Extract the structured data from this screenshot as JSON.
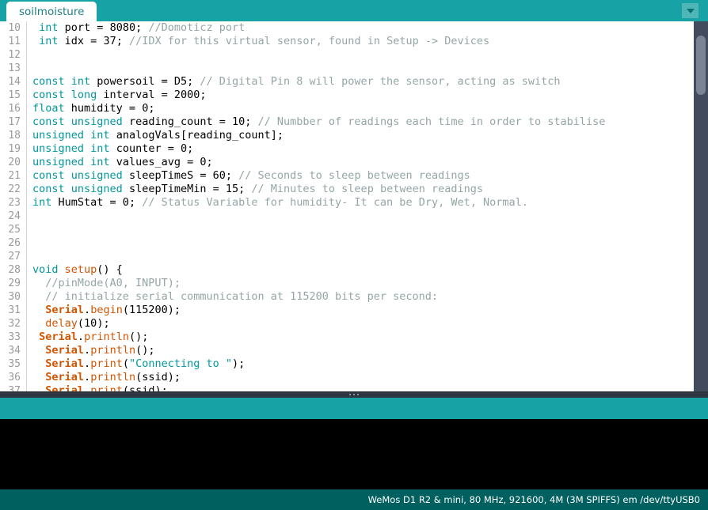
{
  "window": {
    "title": "soilmoisture",
    "theme_accent": "#17a2a5",
    "status_bar_color": "#00605f",
    "console_bg": "#000000",
    "splitter_color": "#2e3440"
  },
  "tabbar": {
    "tabs": [
      {
        "label": "soilmoisture",
        "active": true
      }
    ],
    "menu_button_icon": "chevron-down-icon"
  },
  "editor": {
    "first_visible_line": 10,
    "last_visible_line": 37,
    "lines": [
      {
        "n": "10",
        "tokens": [
          {
            "t": " ",
            "c": "op"
          },
          {
            "t": "int",
            "c": "kw"
          },
          {
            "t": " port = ",
            "c": "op"
          },
          {
            "t": "8080",
            "c": "num"
          },
          {
            "t": "; ",
            "c": "op"
          },
          {
            "t": "//Domoticz port",
            "c": "cmt"
          }
        ]
      },
      {
        "n": "11",
        "tokens": [
          {
            "t": " ",
            "c": "op"
          },
          {
            "t": "int",
            "c": "kw"
          },
          {
            "t": " idx = ",
            "c": "op"
          },
          {
            "t": "37",
            "c": "num"
          },
          {
            "t": "; ",
            "c": "op"
          },
          {
            "t": "//IDX for this virtual sensor, found in Setup -> Devices",
            "c": "cmt"
          }
        ]
      },
      {
        "n": "12",
        "tokens": []
      },
      {
        "n": "13",
        "tokens": []
      },
      {
        "n": "14",
        "tokens": [
          {
            "t": "const",
            "c": "kw"
          },
          {
            "t": " ",
            "c": "op"
          },
          {
            "t": "int",
            "c": "kw"
          },
          {
            "t": " powersoil = D5; ",
            "c": "op"
          },
          {
            "t": "// Digital Pin 8 will power the sensor, acting as switch",
            "c": "cmt"
          }
        ]
      },
      {
        "n": "15",
        "tokens": [
          {
            "t": "const",
            "c": "kw"
          },
          {
            "t": " ",
            "c": "op"
          },
          {
            "t": "long",
            "c": "kw"
          },
          {
            "t": " interval = ",
            "c": "op"
          },
          {
            "t": "2000",
            "c": "num"
          },
          {
            "t": ";",
            "c": "op"
          }
        ]
      },
      {
        "n": "16",
        "tokens": [
          {
            "t": "float",
            "c": "kw"
          },
          {
            "t": " humidity = ",
            "c": "op"
          },
          {
            "t": "0",
            "c": "num"
          },
          {
            "t": ";",
            "c": "op"
          }
        ]
      },
      {
        "n": "17",
        "tokens": [
          {
            "t": "const",
            "c": "kw"
          },
          {
            "t": " ",
            "c": "op"
          },
          {
            "t": "unsigned",
            "c": "kw"
          },
          {
            "t": " reading_count = ",
            "c": "op"
          },
          {
            "t": "10",
            "c": "num"
          },
          {
            "t": "; ",
            "c": "op"
          },
          {
            "t": "// Numbber of readings each time in order to stabilise",
            "c": "cmt"
          }
        ]
      },
      {
        "n": "18",
        "tokens": [
          {
            "t": "unsigned",
            "c": "kw"
          },
          {
            "t": " ",
            "c": "op"
          },
          {
            "t": "int",
            "c": "kw"
          },
          {
            "t": " analogVals[reading_count];",
            "c": "op"
          }
        ]
      },
      {
        "n": "19",
        "tokens": [
          {
            "t": "unsigned",
            "c": "kw"
          },
          {
            "t": " ",
            "c": "op"
          },
          {
            "t": "int",
            "c": "kw"
          },
          {
            "t": " counter = ",
            "c": "op"
          },
          {
            "t": "0",
            "c": "num"
          },
          {
            "t": ";",
            "c": "op"
          }
        ]
      },
      {
        "n": "20",
        "tokens": [
          {
            "t": "unsigned",
            "c": "kw"
          },
          {
            "t": " ",
            "c": "op"
          },
          {
            "t": "int",
            "c": "kw"
          },
          {
            "t": " values_avg = ",
            "c": "op"
          },
          {
            "t": "0",
            "c": "num"
          },
          {
            "t": ";",
            "c": "op"
          }
        ]
      },
      {
        "n": "21",
        "tokens": [
          {
            "t": "const",
            "c": "kw"
          },
          {
            "t": " ",
            "c": "op"
          },
          {
            "t": "unsigned",
            "c": "kw"
          },
          {
            "t": " sleepTimeS = ",
            "c": "op"
          },
          {
            "t": "60",
            "c": "num"
          },
          {
            "t": "; ",
            "c": "op"
          },
          {
            "t": "// Seconds to sleep between readings",
            "c": "cmt"
          }
        ]
      },
      {
        "n": "22",
        "tokens": [
          {
            "t": "const",
            "c": "kw"
          },
          {
            "t": " ",
            "c": "op"
          },
          {
            "t": "unsigned",
            "c": "kw"
          },
          {
            "t": " sleepTimeMin = ",
            "c": "op"
          },
          {
            "t": "15",
            "c": "num"
          },
          {
            "t": "; ",
            "c": "op"
          },
          {
            "t": "// Minutes to sleep between readings",
            "c": "cmt"
          }
        ]
      },
      {
        "n": "23",
        "tokens": [
          {
            "t": "int",
            "c": "kw"
          },
          {
            "t": " HumStat = ",
            "c": "op"
          },
          {
            "t": "0",
            "c": "num"
          },
          {
            "t": "; ",
            "c": "op"
          },
          {
            "t": "// Status Variable for humidity- It can be Dry, Wet, Normal.",
            "c": "cmt"
          }
        ]
      },
      {
        "n": "24",
        "tokens": []
      },
      {
        "n": "25",
        "tokens": []
      },
      {
        "n": "26",
        "tokens": []
      },
      {
        "n": "27",
        "tokens": []
      },
      {
        "n": "28",
        "tokens": [
          {
            "t": "void",
            "c": "kw"
          },
          {
            "t": " ",
            "c": "op"
          },
          {
            "t": "setup",
            "c": "fn"
          },
          {
            "t": "() {",
            "c": "op"
          }
        ]
      },
      {
        "n": "29",
        "tokens": [
          {
            "t": "  ",
            "c": "op"
          },
          {
            "t": "//pinMode(A0, INPUT);",
            "c": "cmt"
          }
        ]
      },
      {
        "n": "30",
        "tokens": [
          {
            "t": "  ",
            "c": "op"
          },
          {
            "t": "// initialize serial communication at 115200 bits per second:",
            "c": "cmt"
          }
        ]
      },
      {
        "n": "31",
        "tokens": [
          {
            "t": "  ",
            "c": "op"
          },
          {
            "t": "Serial",
            "c": "obj"
          },
          {
            "t": ".",
            "c": "op"
          },
          {
            "t": "begin",
            "c": "fn"
          },
          {
            "t": "(",
            "c": "op"
          },
          {
            "t": "115200",
            "c": "num"
          },
          {
            "t": ");",
            "c": "op"
          }
        ]
      },
      {
        "n": "32",
        "tokens": [
          {
            "t": "  ",
            "c": "op"
          },
          {
            "t": "delay",
            "c": "fn"
          },
          {
            "t": "(",
            "c": "op"
          },
          {
            "t": "10",
            "c": "num"
          },
          {
            "t": ");",
            "c": "op"
          }
        ]
      },
      {
        "n": "33",
        "tokens": [
          {
            "t": " ",
            "c": "op"
          },
          {
            "t": "Serial",
            "c": "obj"
          },
          {
            "t": ".",
            "c": "op"
          },
          {
            "t": "println",
            "c": "fn"
          },
          {
            "t": "();",
            "c": "op"
          }
        ]
      },
      {
        "n": "34",
        "tokens": [
          {
            "t": "  ",
            "c": "op"
          },
          {
            "t": "Serial",
            "c": "obj"
          },
          {
            "t": ".",
            "c": "op"
          },
          {
            "t": "println",
            "c": "fn"
          },
          {
            "t": "();",
            "c": "op"
          }
        ]
      },
      {
        "n": "35",
        "tokens": [
          {
            "t": "  ",
            "c": "op"
          },
          {
            "t": "Serial",
            "c": "obj"
          },
          {
            "t": ".",
            "c": "op"
          },
          {
            "t": "print",
            "c": "fn"
          },
          {
            "t": "(",
            "c": "op"
          },
          {
            "t": "\"Connecting to \"",
            "c": "str"
          },
          {
            "t": ");",
            "c": "op"
          }
        ]
      },
      {
        "n": "36",
        "tokens": [
          {
            "t": "  ",
            "c": "op"
          },
          {
            "t": "Serial",
            "c": "obj"
          },
          {
            "t": ".",
            "c": "op"
          },
          {
            "t": "println",
            "c": "fn"
          },
          {
            "t": "(ssid);",
            "c": "op"
          }
        ]
      },
      {
        "n": "37",
        "tokens": [
          {
            "t": "  ",
            "c": "op"
          },
          {
            "t": "Serial",
            "c": "obj"
          },
          {
            "t": ".",
            "c": "op"
          },
          {
            "t": "print",
            "c": "fn"
          },
          {
            "t": "(ssid);",
            "c": "op"
          }
        ]
      }
    ]
  },
  "console": {
    "output_text": ""
  },
  "statusbar": {
    "board_info": "WeMos D1 R2 & mini, 80 MHz, 921600, 4M (3M SPIFFS) em /dev/ttyUSB0"
  }
}
